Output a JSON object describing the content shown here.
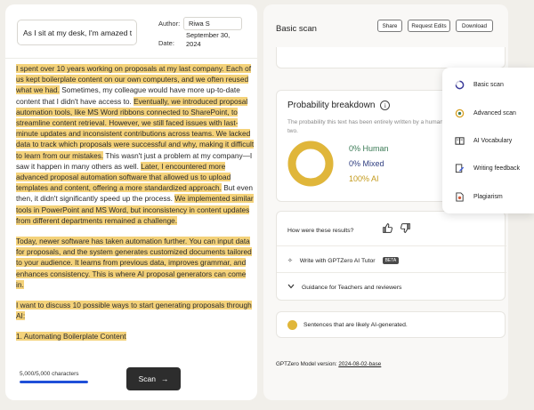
{
  "document": {
    "title_value": "As I sit at my desk, I'm amazed t",
    "author_label": "Author:",
    "author_value": "Riwa S",
    "date_label": "Date:",
    "date_value": "September 30, 2024",
    "paragraphs": [
      [
        {
          "t": "I spent over 10 years working on proposals at my last company. Each of us kept boilerplate content on our own computers, and we often reused what we had.",
          "ai": true
        },
        {
          "t": " Sometimes, my colleague would have more up-to-date content that I didn't have access to. ",
          "ai": false
        },
        {
          "t": "Eventually, we introduced proposal automation tools, like MS Word ribbons connected to SharePoint, to streamline content retrieval. However, we still faced issues with last-minute updates and inconsistent contributions across teams. We lacked data to track which proposals were successful and why, making it difficult to learn from our mistakes.",
          "ai": true
        },
        {
          "t": " This wasn't just a problem at my company—I saw it happen in many others as well. ",
          "ai": false
        },
        {
          "t": "Later, I encountered more advanced proposal automation software that allowed us to upload templates and content, offering a more standardized approach.",
          "ai": true
        },
        {
          "t": " But even then, it didn't significantly speed up the process. ",
          "ai": false
        },
        {
          "t": "We implemented similar tools in PowerPoint and MS Word, but inconsistency in content updates from different departments remained a challenge.",
          "ai": true
        }
      ],
      [
        {
          "t": "Today, newer software has taken automation further. You can input data for proposals, and the system generates customized documents tailored to your audience. It learns from previous data, improves grammar, and enhances consistency. This is where AI proposal generators can come in.",
          "ai": true
        }
      ],
      [
        {
          "t": "I want to discuss 10 possible ways to start generating proposals through AI:",
          "ai": true
        }
      ],
      [
        {
          "t": "1. Automating Boilerplate Content",
          "ai": true
        }
      ]
    ],
    "char_count": "5,000/5,000 characters",
    "char_progress": 1.0,
    "scan_label": "Scan"
  },
  "results": {
    "title": "Basic scan",
    "share_label": "Share",
    "request_edits_label": "Request Edits",
    "download_label": "Download",
    "prob_title": "Probability breakdown",
    "prob_desc": "The probability this text has been entirely written by a human, AI, or a mix of the two.",
    "human_pct": 0,
    "mixed_pct": 0,
    "ai_pct": 100,
    "human_label": "0% Human",
    "mixed_label": "0% Mixed",
    "ai_label": "100% AI",
    "feedback_question": "How were these results?",
    "tutor_label": "Write with GPTZero AI Tutor",
    "beta_label": "BETA",
    "guidance_label": "Guidance for Teachers and reviewers",
    "legend_label": "Sentences that are likely AI-generated.",
    "model_version_label": "GPTZero Model version:",
    "model_version_value": "2024-08-02-base",
    "colors": {
      "human": "#3a7a55",
      "mixed": "#2f3e80",
      "ai": "#e0b63a",
      "highlight": "#f4d27a"
    }
  },
  "menu": {
    "items": [
      {
        "label": "Basic scan",
        "icon": "circle-progress-icon",
        "active": true
      },
      {
        "label": "Advanced scan",
        "icon": "magnify-scan-icon",
        "active": false
      },
      {
        "label": "AI Vocabulary",
        "icon": "book-icon",
        "active": false
      },
      {
        "label": "Writing feedback",
        "icon": "pen-doc-icon",
        "active": false
      },
      {
        "label": "Plagiarism",
        "icon": "doc-plagiarism-icon",
        "active": false
      }
    ]
  }
}
